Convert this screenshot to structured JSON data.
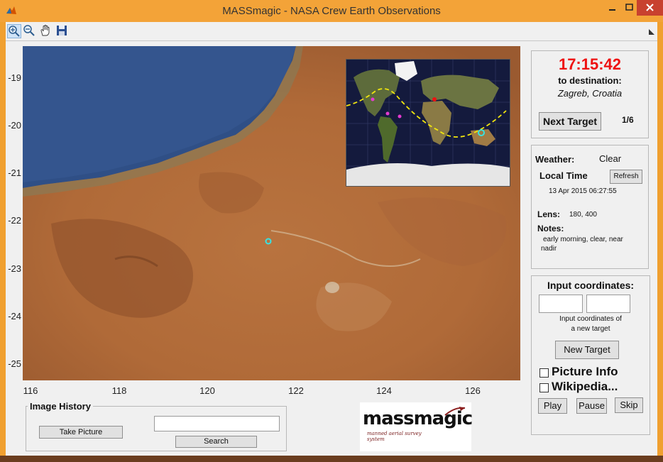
{
  "window": {
    "title": "MASSmagic - NASA Crew Earth Observations"
  },
  "toolbar": {
    "tools": [
      "zoom-in-icon",
      "zoom-out-icon",
      "pan-icon",
      "save-icon"
    ]
  },
  "map": {
    "y_ticks": [
      "-19",
      "-20",
      "-21",
      "-22",
      "-23",
      "-24",
      "-25"
    ],
    "x_ticks": [
      "116",
      "118",
      "120",
      "122",
      "124",
      "126"
    ]
  },
  "destination": {
    "countdown": "17:15:42",
    "to_label": "to destination:",
    "name": "Zagreb, Croatia",
    "next_button": "Next Target",
    "counter": "1/6"
  },
  "info": {
    "weather_label": "Weather:",
    "weather_value": "Clear",
    "local_time_label": "Local Time",
    "refresh_button": "Refresh",
    "local_time_value": "13 Apr 2015 06:27:55",
    "lens_label": "Lens:",
    "lens_value": "180, 400",
    "notes_label": "Notes:",
    "notes_line1": "early morning, clear, near",
    "notes_line2": "nadir"
  },
  "coords": {
    "title": "Input coordinates:",
    "help_line1": "Input coordinates of",
    "help_line2": "a new target",
    "new_target_button": "New Target",
    "picture_info_label": "Picture Info",
    "wikipedia_label": "Wikipedia...",
    "play_button": "Play",
    "pause_button": "Pause",
    "skip_button": "Skip"
  },
  "history": {
    "title": "Image History",
    "take_picture_button": "Take Picture",
    "search_button": "Search"
  },
  "logo": {
    "text": "massmagic",
    "tagline": "manned aerial survey system"
  }
}
